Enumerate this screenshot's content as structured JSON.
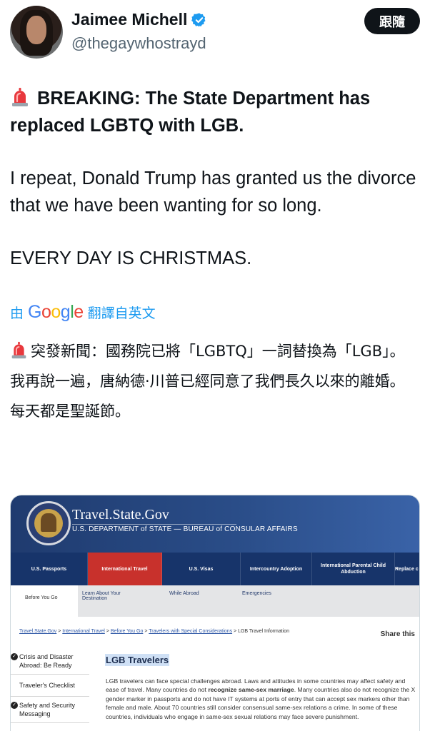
{
  "user": {
    "name": "Jaimee Michell",
    "handle": "@thegaywhostrayd",
    "follow_label": "跟隨"
  },
  "tweet": {
    "headline": "BREAKING: The State Department has replaced LGBTQ with LGB.",
    "para2": "I repeat, Donald Trump has granted us the divorce that we have been wanting for so long.",
    "para3": "EVERY DAY IS CHRISTMAS."
  },
  "translation": {
    "prefix": "由",
    "google_word": "Google",
    "suffix": "翻譯自英文",
    "line1": "突發新聞：國務院已將「LGBTQ」一詞替換為「LGB」。",
    "line2": "我再說一遍，唐納德·川普已經同意了我們長久以來的離婚。",
    "line3": "每天都是聖誕節。"
  },
  "embedded_page": {
    "site_title": "Travel.State.Gov",
    "site_subtitle": "U.S. DEPARTMENT of STATE — BUREAU of CONSULAR AFFAIRS",
    "nav": [
      "U.S. Passports",
      "International Travel",
      "U.S. Visas",
      "Intercountry Adoption",
      "International Parental Child Abduction",
      "Replace c"
    ],
    "subnav": [
      "Before You Go",
      "Learn About Your Destination",
      "While Abroad",
      "Emergencies"
    ],
    "breadcrumb": {
      "links": [
        "Travel.State.Gov",
        "International Travel",
        "Before You Go",
        "Travelers with Special Considerations"
      ],
      "current": "LGB Travel Information",
      "separator": ">"
    },
    "share_label": "Share this",
    "left_nav": [
      "Crisis and Disaster Abroad: Be Ready",
      "Traveler's Checklist",
      "Safety and Security Messaging"
    ],
    "article_title": "LGB Travelers",
    "article_text_1": "LGB travelers can face special challenges abroad. Laws and attitudes in some countries may affect safety and ease of travel. Many countries do not ",
    "article_bold": "recognize same-sex marriage",
    "article_text_2": ". Many countries also do not recognize the X gender marker in passports and do not have IT systems at ports of entry that can accept sex markers other than female and male. About 70 countries still consider consensual same-sex relations a crime. In some of these countries, individuals who engage in same-sex sexual relations may face severe punishment."
  },
  "colors": {
    "accent": "#1d9bf0",
    "text": "#0f1419",
    "secondary": "#536471",
    "site_navy": "#17346a",
    "site_red": "#c8312c"
  },
  "icons": [
    "verified-badge-icon",
    "siren-icon",
    "google-logo"
  ]
}
